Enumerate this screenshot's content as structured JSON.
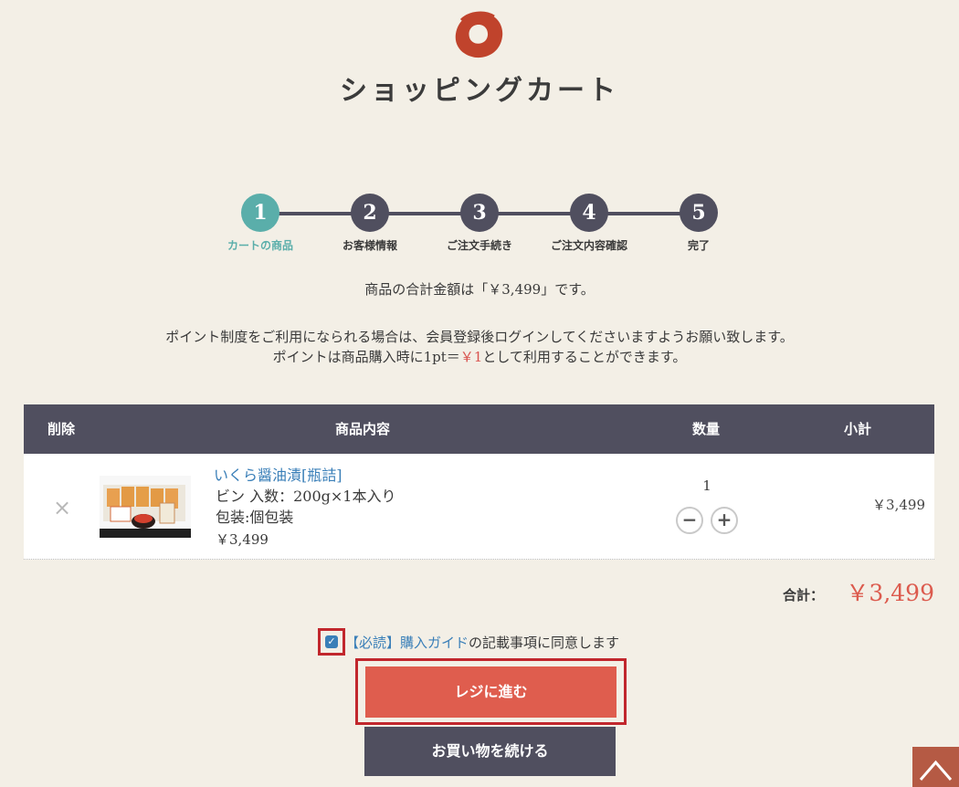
{
  "page": {
    "title": "ショッピングカート"
  },
  "steps": [
    {
      "num": "1",
      "label": "カートの商品"
    },
    {
      "num": "2",
      "label": "お客様情報"
    },
    {
      "num": "3",
      "label": "ご注文手続き"
    },
    {
      "num": "4",
      "label": "ご注文内容確認"
    },
    {
      "num": "5",
      "label": "完了"
    }
  ],
  "summary": "商品の合計金額は「￥3,499」です。",
  "notice": {
    "line1": "ポイント制度をご利用になられる場合は、会員登録後ログインしてくださいますようお願い致します。",
    "line2_pre": "ポイントは商品購入時に1pt＝",
    "line2_price": "￥1",
    "line2_post": "として利用することができます。"
  },
  "table": {
    "headers": {
      "remove": "削除",
      "product": "商品内容",
      "qty": "数量",
      "subtotal": "小計"
    },
    "rows": [
      {
        "remove": "×",
        "name": "いくら醤油漬[瓶詰]",
        "spec": "ビン 入数：200g×1本入り",
        "wrap": "包装:個包装",
        "price": "￥3,499",
        "qty": "1",
        "minus": "−",
        "plus": "+",
        "subtotal": "￥3,499"
      }
    ]
  },
  "total": {
    "label": "合計：",
    "value": "￥3,499"
  },
  "agree": {
    "check": "✓",
    "link": "【必読】購入ガイド",
    "text": "の記載事項に同意します"
  },
  "buttons": {
    "checkout": "レジに進む",
    "continue": "お買い物を続ける"
  },
  "colors": {
    "accent": "#5aaeaa",
    "dark": "#504f5f",
    "red": "#df5d4e",
    "link": "#3a7fb8"
  }
}
